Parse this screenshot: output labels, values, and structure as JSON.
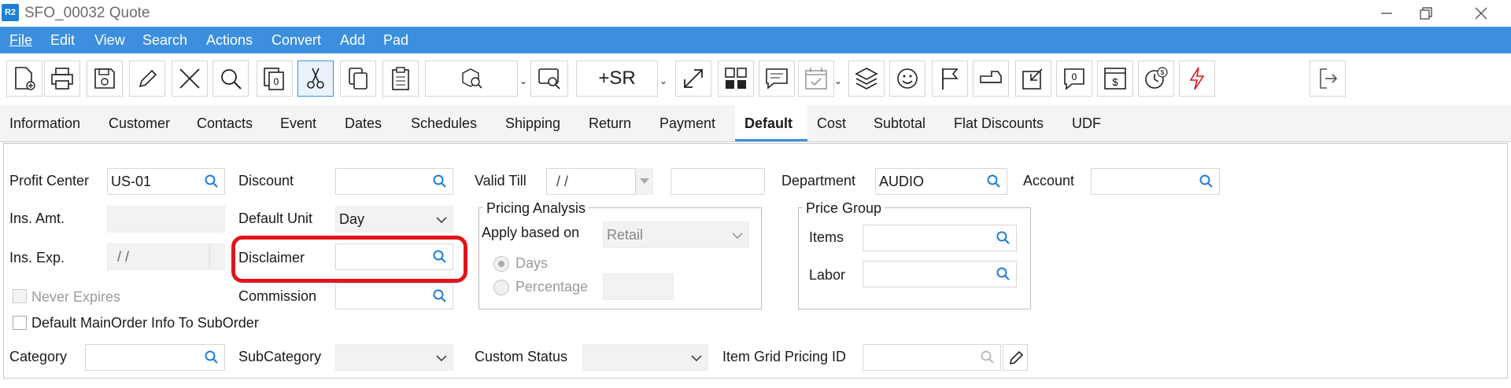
{
  "window": {
    "logo": "R2",
    "title": "SFO_00032 Quote"
  },
  "menu": [
    "File",
    "Edit",
    "View",
    "Search",
    "Actions",
    "Convert",
    "Add",
    "Pad"
  ],
  "toolbar": {
    "sr_label": "+SR"
  },
  "tabs": [
    "Information",
    "Customer",
    "Contacts",
    "Event",
    "Dates",
    "Schedules",
    "Shipping",
    "Return",
    "Payment",
    "Default",
    "Cost",
    "Subtotal",
    "Flat Discounts",
    "UDF"
  ],
  "active_tab": "Default",
  "form": {
    "profit_center": {
      "label": "Profit Center",
      "value": "US-01"
    },
    "ins_amt": {
      "label": "Ins. Amt.",
      "value": ""
    },
    "ins_exp": {
      "label": "Ins. Exp.",
      "value": "/ /"
    },
    "never_expires": {
      "label": "Never Expires",
      "checked": false
    },
    "default_mainorder": {
      "label": "Default MainOrder Info To SubOrder",
      "checked": false
    },
    "category": {
      "label": "Category",
      "value": ""
    },
    "discount": {
      "label": "Discount",
      "value": ""
    },
    "default_unit": {
      "label": "Default Unit",
      "value": "Day"
    },
    "disclaimer": {
      "label": "Disclaimer",
      "value": ""
    },
    "commission": {
      "label": "Commission",
      "value": ""
    },
    "subcategory": {
      "label": "SubCategory",
      "value": ""
    },
    "valid_till": {
      "label": "Valid Till",
      "value": "/ /"
    },
    "pricing_analysis": {
      "title": "Pricing Analysis",
      "apply_label": "Apply based on",
      "apply_value": "Retail",
      "days_label": "Days",
      "percentage_label": "Percentage",
      "selected": "Days"
    },
    "custom_status": {
      "label": "Custom Status",
      "value": ""
    },
    "department": {
      "label": "Department",
      "value": "AUDIO"
    },
    "account": {
      "label": "Account",
      "value": ""
    },
    "price_group": {
      "title": "Price Group",
      "items_label": "Items",
      "labor_label": "Labor"
    },
    "item_grid_pricing": {
      "label": "Item Grid Pricing ID",
      "value": ""
    }
  },
  "colors": {
    "menu_bg": "#3b8fde",
    "accent": "#1e7fd6",
    "highlight": "#e0151c"
  }
}
